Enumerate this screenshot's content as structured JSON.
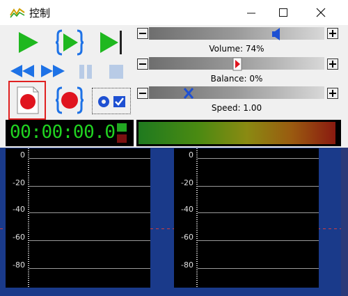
{
  "window": {
    "title": "控制"
  },
  "sliders": {
    "volume": {
      "label": "Volume: 74%",
      "value": 0.74
    },
    "balance": {
      "label": "Balance: 0%",
      "value": 0.5
    },
    "speed": {
      "label": "Speed: 1.00",
      "value": 0.33
    }
  },
  "time": {
    "display": "00:00:00.0"
  },
  "scopes": {
    "ticks": [
      "0",
      "-20",
      "-40",
      "-60",
      "-80"
    ]
  },
  "colors": {
    "accent_green": "#1fb81f",
    "accent_blue": "#1e72e6",
    "record_red": "#e0141e",
    "record_border": "#e02020",
    "time_green": "#21d321"
  }
}
